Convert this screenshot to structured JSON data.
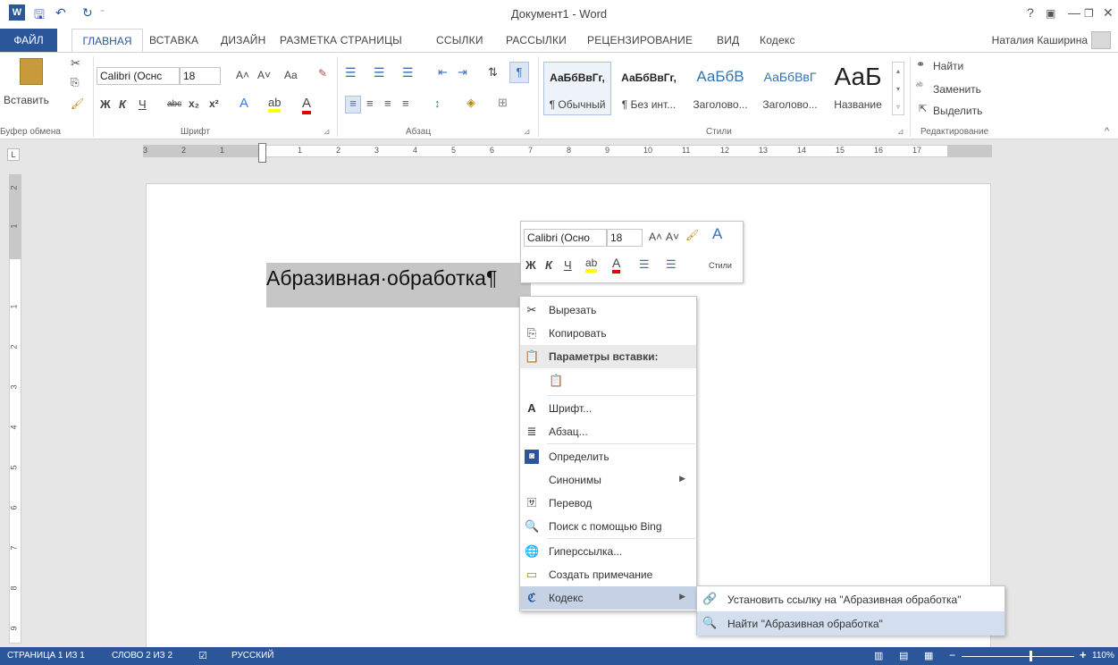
{
  "window": {
    "title": "Документ1 - Word",
    "help": "?",
    "minimize": "—",
    "close": "✕"
  },
  "quick_access": {
    "word_icon": "W",
    "save": "🖫",
    "undo": "↶",
    "redo": "↻"
  },
  "tabs": {
    "file": "ФАЙЛ",
    "items": [
      "ГЛАВНАЯ",
      "ВСТАВКА",
      "ДИЗАЙН",
      "РАЗМЕТКА СТРАНИЦЫ",
      "ССЫЛКИ",
      "РАССЫЛКИ",
      "РЕЦЕНЗИРОВАНИЕ",
      "ВИД",
      "Кодекс"
    ],
    "user": "Наталия Каширина"
  },
  "ribbon": {
    "clipboard": {
      "paste": "Вставить",
      "label": "Буфер обмена"
    },
    "font": {
      "family": "Calibri (Оснс",
      "size": "18",
      "bold": "Ж",
      "italic": "К",
      "underline": "Ч",
      "strike": "abc",
      "sub": "x₂",
      "sup": "x²",
      "grow": "A˄",
      "shrink": "A˅",
      "case": "Aa",
      "label": "Шрифт"
    },
    "paragraph": {
      "label": "Абзац"
    },
    "styles": {
      "items": [
        {
          "preview": "АаБбВвГг,",
          "name": "¶ Обычный"
        },
        {
          "preview": "АаБбВвГг,",
          "name": "¶ Без инт..."
        },
        {
          "preview": "АаБбВ",
          "name": "Заголово..."
        },
        {
          "preview": "АаБбВвГ",
          "name": "Заголово..."
        },
        {
          "preview": "АаБ",
          "name": "Название"
        }
      ],
      "label": "Стили"
    },
    "editing": {
      "find": "Найти",
      "replace": "Заменить",
      "select": "Выделить",
      "label": "Редактирование"
    }
  },
  "ruler": {
    "marks": [
      "3",
      "2",
      "1",
      "1",
      "2",
      "3",
      "4",
      "5",
      "6",
      "7",
      "8",
      "9",
      "10",
      "11",
      "12",
      "13",
      "14",
      "15",
      "16",
      "17"
    ],
    "vmarks": [
      "2",
      "1",
      "1",
      "2",
      "3",
      "4",
      "5",
      "6",
      "7",
      "8",
      "9"
    ]
  },
  "document": {
    "selected_text": "Абразивная·обработка¶"
  },
  "mini_toolbar": {
    "font": "Calibri (Осно",
    "size": "18",
    "styles": "Стили",
    "bold": "Ж",
    "italic": "К",
    "underline": "Ч"
  },
  "context_menu": {
    "cut": "Вырезать",
    "copy": "Копировать",
    "paste_options": "Параметры вставки:",
    "font": "Шрифт...",
    "paragraph": "Абзац...",
    "define": "Определить",
    "synonyms": "Синонимы",
    "translate": "Перевод",
    "bing": "Поиск с помощью Bing",
    "hyperlink": "Гиперссылка...",
    "comment": "Создать примечание",
    "kodeks": "Кодекс"
  },
  "submenu": {
    "link": "Установить ссылку на \"Абразивная обработка\"",
    "find": "Найти \"Абразивная обработка\""
  },
  "statusbar": {
    "page": "СТРАНИЦА 1 ИЗ 1",
    "words": "СЛОВО 2 ИЗ 2",
    "language": "РУССКИЙ",
    "zoom": "110%",
    "zoom_minus": "−",
    "zoom_plus": "+"
  },
  "colors": {
    "accent": "#2b579a",
    "highlight_selected": "#c6c6c6",
    "menu_hover": "#c5d2e6"
  }
}
